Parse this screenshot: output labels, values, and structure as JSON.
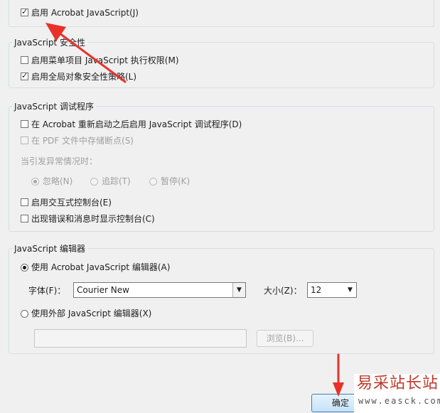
{
  "top_option": {
    "label": "启用 Acrobat JavaScript(J)",
    "checked": true
  },
  "security_group": {
    "title": "JavaScript 安全性",
    "items": [
      {
        "label": "启用菜单项目 JavaScript 执行权限(M)",
        "checked": false
      },
      {
        "label": "启用全局对象安全性策略(L)",
        "checked": true
      }
    ]
  },
  "debugger_group": {
    "title": "JavaScript 调试程序",
    "items": [
      {
        "label": "在 Acrobat 重新启动之后启用 JavaScript 调试程序(D)",
        "checked": false
      },
      {
        "label": "在 PDF 文件中存储断点(S)",
        "checked": false,
        "disabled": true
      }
    ],
    "exception_label": "当引发异常情况时：",
    "exception_options": [
      {
        "label": "忽略(N)",
        "selected": true
      },
      {
        "label": "追踪(T)",
        "selected": false
      },
      {
        "label": "暂停(K)",
        "selected": false
      }
    ],
    "console_items": [
      {
        "label": "启用交互式控制台(E)",
        "checked": false
      },
      {
        "label": "出现错误和消息时显示控制台(C)",
        "checked": false
      }
    ]
  },
  "editor_group": {
    "title": "JavaScript 编辑器",
    "use_acrobat_label": "使用 Acrobat JavaScript 编辑器(A)",
    "font_label": "字体(F)：",
    "font_value": "Courier New",
    "size_label": "大小(Z)：",
    "size_value": "12",
    "use_external_label": "使用外部 JavaScript 编辑器(X)",
    "external_path": "",
    "browse_label": "浏览(B)..."
  },
  "ok_button": "确定",
  "watermark": {
    "title": "易采站长站",
    "url": "www.easck.com"
  },
  "colors": {
    "annotation_arrow": "#e8312a",
    "watermark_red": "#c0392b"
  }
}
